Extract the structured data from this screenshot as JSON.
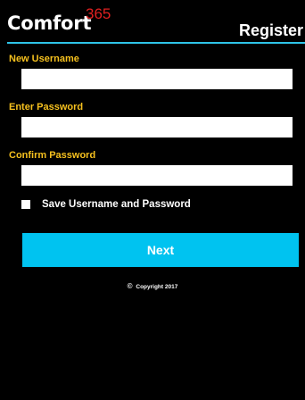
{
  "header": {
    "brand_name": "Comfort",
    "brand_number": "365",
    "page_title": "Register"
  },
  "form": {
    "new_username_label": "New Username",
    "new_username_value": "",
    "enter_password_label": "Enter Password",
    "enter_password_value": "",
    "confirm_password_label": "Confirm Password",
    "confirm_password_value": "",
    "save_credentials_label": "Save Username and Password",
    "save_credentials_checked": false,
    "next_label": "Next"
  },
  "footer": {
    "copyright_symbol": "©",
    "copyright_text": "Copyright 2017"
  },
  "colors": {
    "background": "#000000",
    "label": "#f5c01e",
    "accent": "#00c3f0",
    "brand_number": "#e02020"
  }
}
